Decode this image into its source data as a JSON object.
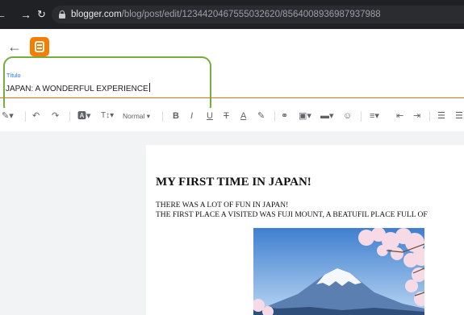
{
  "browser": {
    "url_host": "blogger.com",
    "url_path": "/blog/post/edit/1234420467555032620/8564008936987937988"
  },
  "post_title": {
    "label": "Título",
    "value": "JAPAN: A WONDERFUL EXPERIENCE"
  },
  "toolbar": {
    "format_label": "Normal"
  },
  "post_body": {
    "heading": "MY FIRST TIME IN JAPAN!",
    "line1": "THERE WAS A LOT OF FUN IN JAPAN!",
    "line2": "THE FIRST PLACE A VISITED WAS FUJI MOUNT, A BEATUFIL PLACE FULL OF"
  },
  "colors": {
    "blogger_orange": "#f57d00",
    "title_underline": "#e8710a",
    "annotation_green": "#77ad3e",
    "label_blue": "#1a73e8"
  }
}
